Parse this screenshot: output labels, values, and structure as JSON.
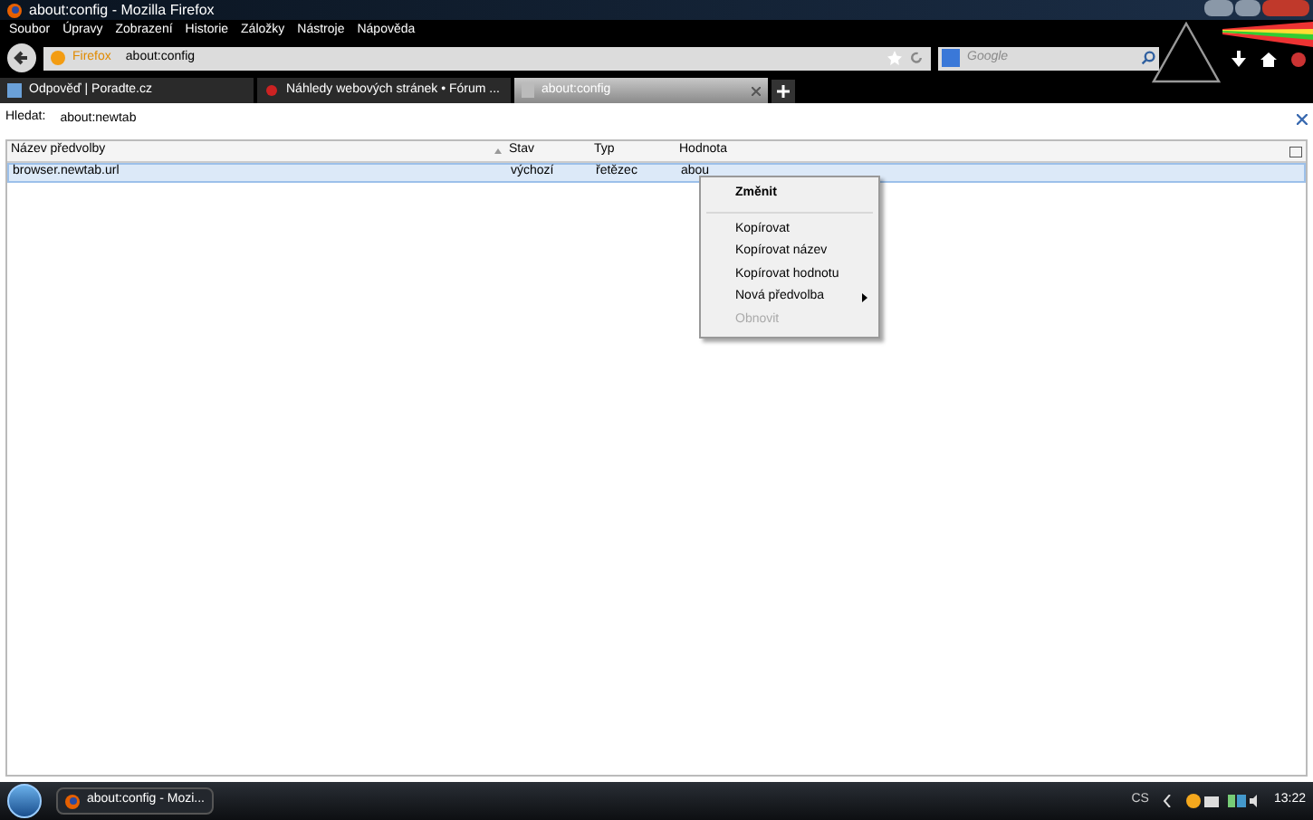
{
  "window": {
    "title": "about:config - Mozilla Firefox"
  },
  "menu_bar": [
    "Soubor",
    "Úpravy",
    "Zobrazení",
    "Historie",
    "Záložky",
    "Nástroje",
    "Nápověda"
  ],
  "nav_bar": {
    "identity": "Firefox",
    "url": "about:config",
    "search_placeholder": "Google"
  },
  "tabs": [
    {
      "label": "Odpověď | Poradte.cz",
      "selected": false,
      "kind": "page"
    },
    {
      "label": "Náhledy webových stránek • Fórum ...",
      "selected": false,
      "kind": "bug"
    },
    {
      "label": "about:config",
      "selected": true,
      "kind": "blank"
    }
  ],
  "search": {
    "label": "Hledat:",
    "value": "about:newtab"
  },
  "table": {
    "columns": [
      "Název předvolby",
      "Stav",
      "Typ",
      "Hodnota"
    ],
    "rows": [
      {
        "cells": [
          "browser.newtab.url",
          "výchozí",
          "řetězec",
          "abou"
        ],
        "selected": true
      }
    ]
  },
  "context_menu": [
    {
      "label": "Změnit",
      "kind": "default",
      "disabled": false
    },
    {
      "kind": "separator"
    },
    {
      "label": "Kopírovat",
      "kind": "item",
      "disabled": false
    },
    {
      "label": "Kopírovat název",
      "kind": "item",
      "disabled": false
    },
    {
      "label": "Kopírovat hodnotu",
      "kind": "item",
      "disabled": false
    },
    {
      "label": "Nová předvolba",
      "kind": "submenu",
      "disabled": false
    },
    {
      "label": "Obnovit",
      "kind": "item",
      "disabled": true
    }
  ],
  "taskbar": {
    "window_button": "about:config - Mozi...",
    "language": "CS",
    "clock": "13:22"
  }
}
